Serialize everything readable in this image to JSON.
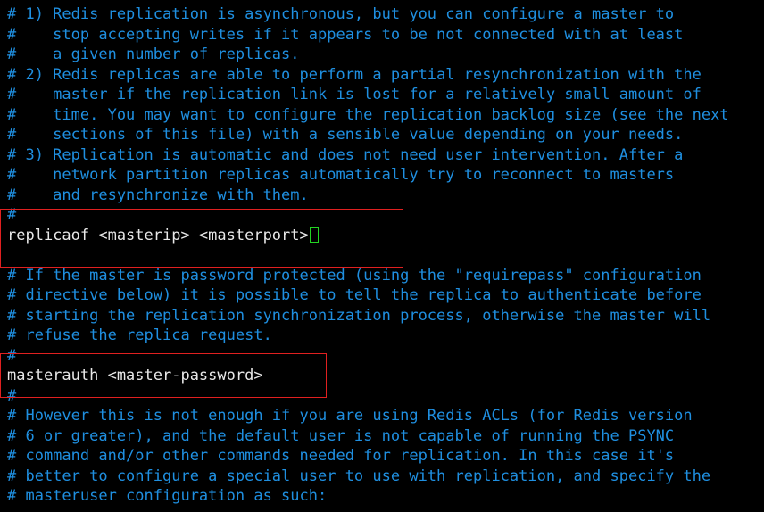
{
  "terminal": {
    "lines": [
      {
        "text": "# 1) Redis replication is asynchronous, but you can configure a master to",
        "kind": "comment"
      },
      {
        "text": "#    stop accepting writes if it appears to be not connected with at least",
        "kind": "comment"
      },
      {
        "text": "#    a given number of replicas.",
        "kind": "comment"
      },
      {
        "text": "# 2) Redis replicas are able to perform a partial resynchronization with the",
        "kind": "comment"
      },
      {
        "text": "#    master if the replication link is lost for a relatively small amount of",
        "kind": "comment"
      },
      {
        "text": "#    time. You may want to configure the replication backlog size (see the next",
        "kind": "comment"
      },
      {
        "text": "#    sections of this file) with a sensible value depending on your needs.",
        "kind": "comment"
      },
      {
        "text": "# 3) Replication is automatic and does not need user intervention. After a",
        "kind": "comment"
      },
      {
        "text": "#    network partition replicas automatically try to reconnect to masters",
        "kind": "comment"
      },
      {
        "text": "#    and resynchronize with them.",
        "kind": "comment"
      },
      {
        "text": "#",
        "kind": "comment"
      },
      {
        "text": "replicaof <masterip> <masterport>",
        "kind": "directive"
      },
      {
        "text": "",
        "kind": "comment"
      },
      {
        "text": "# If the master is password protected (using the \"requirepass\" configuration",
        "kind": "comment"
      },
      {
        "text": "# directive below) it is possible to tell the replica to authenticate before",
        "kind": "comment"
      },
      {
        "text": "# starting the replication synchronization process, otherwise the master will",
        "kind": "comment"
      },
      {
        "text": "# refuse the replica request.",
        "kind": "comment"
      },
      {
        "text": "#",
        "kind": "comment"
      },
      {
        "text": "masterauth <master-password>",
        "kind": "directive"
      },
      {
        "text": "#",
        "kind": "comment"
      },
      {
        "text": "# However this is not enough if you are using Redis ACLs (for Redis version",
        "kind": "comment"
      },
      {
        "text": "# 6 or greater), and the default user is not capable of running the PSYNC",
        "kind": "comment"
      },
      {
        "text": "# command and/or other commands needed for replication. In this case it's",
        "kind": "comment"
      },
      {
        "text": "# better to configure a special user to use with replication, and specify the",
        "kind": "comment"
      },
      {
        "text": "# masteruser configuration as such:",
        "kind": "comment"
      }
    ]
  },
  "colors": {
    "background": "#000000",
    "comment": "#1f8fe0",
    "directive": "#e8e8e8",
    "cursor": "#22d422",
    "highlight": "#e02020"
  }
}
